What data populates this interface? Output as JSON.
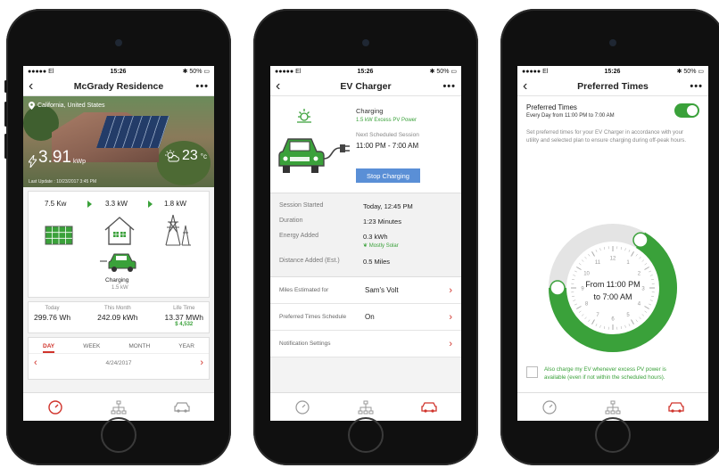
{
  "colors": {
    "accent_green": "#3aa13a",
    "accent_red": "#d0332b",
    "button_blue": "#5a8fd6"
  },
  "status": {
    "carrier": "●●●●● El",
    "time": "15:26",
    "battery": "50%"
  },
  "phone1": {
    "title": "McGrady Residence",
    "location": "California, United States",
    "kwp_value": "3.91",
    "kwp_unit": "kWp",
    "temp_value": "23",
    "temp_unit": "°c",
    "last_update": "Last Update : 10/23/2017  3:45 PM",
    "flow": {
      "solar": "7.5 Kw",
      "home": "3.3 kW",
      "grid": "1.8 kW",
      "charging_label": "Charging",
      "charging_value": "1.5 kW"
    },
    "stats": [
      {
        "label": "Today",
        "value": "299.76 Wh"
      },
      {
        "label": "This Month",
        "value": "242.09 kWh"
      },
      {
        "label": "Life Time",
        "value": "13.37 MWh",
        "money": "$ 4,532"
      }
    ],
    "periods": [
      "DAY",
      "WEEK",
      "MONTH",
      "YEAR"
    ],
    "date": "4/24/2017"
  },
  "phone2": {
    "title": "EV Charger",
    "charging": "Charging",
    "charging_sub": "1.5 kW Excess PV Power",
    "next_label": "Next Scheduled Session",
    "next_value": "11:00 PM - 7:00 AM",
    "stop_label": "Stop Charging",
    "session": [
      {
        "k": "Session Started",
        "v": "Today, 12:45 PM"
      },
      {
        "k": "Duration",
        "v": "1:23 Minutes"
      },
      {
        "k": "Energy Added",
        "v": "0.3 kWh",
        "note": "Mostly Solar"
      },
      {
        "k": "Distance Added  (Est.)",
        "v": "0.5 Miles"
      }
    ],
    "settings": [
      {
        "k": "Miles Estimated for",
        "v": "Sam's Volt"
      },
      {
        "k": "Preferred Times Schedule",
        "v": "On"
      },
      {
        "k": "Notification Settings",
        "v": ""
      }
    ]
  },
  "phone3": {
    "title": "Preferred Times",
    "heading": "Preferred Times",
    "subheading": "Every Day from 11:00 PM to 7:00 AM",
    "description": "Set preferred times for your EV Charger in accordance with your utility and selected plan to ensure charging during off-peak hours.",
    "clock_line1": "From 11:00 PM",
    "clock_line2": "to 7:00 AM",
    "clock_numbers": [
      "12",
      "1",
      "2",
      "3",
      "4",
      "5",
      "6",
      "7",
      "8",
      "9",
      "10",
      "11"
    ],
    "clock_fraction": 0.33,
    "checkbox_text": "Also charge my EV whenever excess PV power is available (even if not within the scheduled hours)."
  }
}
